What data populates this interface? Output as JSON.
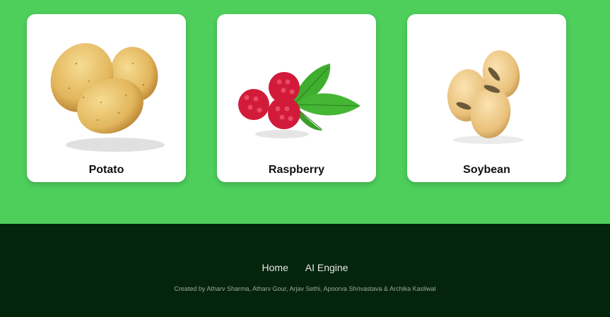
{
  "cards": [
    {
      "label": "Potato",
      "icon": "potato-image"
    },
    {
      "label": "Raspberry",
      "icon": "raspberry-image"
    },
    {
      "label": "Soybean",
      "icon": "soybean-image"
    }
  ],
  "footer": {
    "nav": [
      {
        "label": "Home"
      },
      {
        "label": "AI Engine"
      }
    ],
    "credits": "Created by Atharv Sharma, Atharv Gour, Arjav Sethi, Apoorva Shrivastava & Archika Kasliwal"
  },
  "colors": {
    "page_bg": "#4ecf5c",
    "footer_bg": "#04240c",
    "card_bg": "#ffffff"
  }
}
